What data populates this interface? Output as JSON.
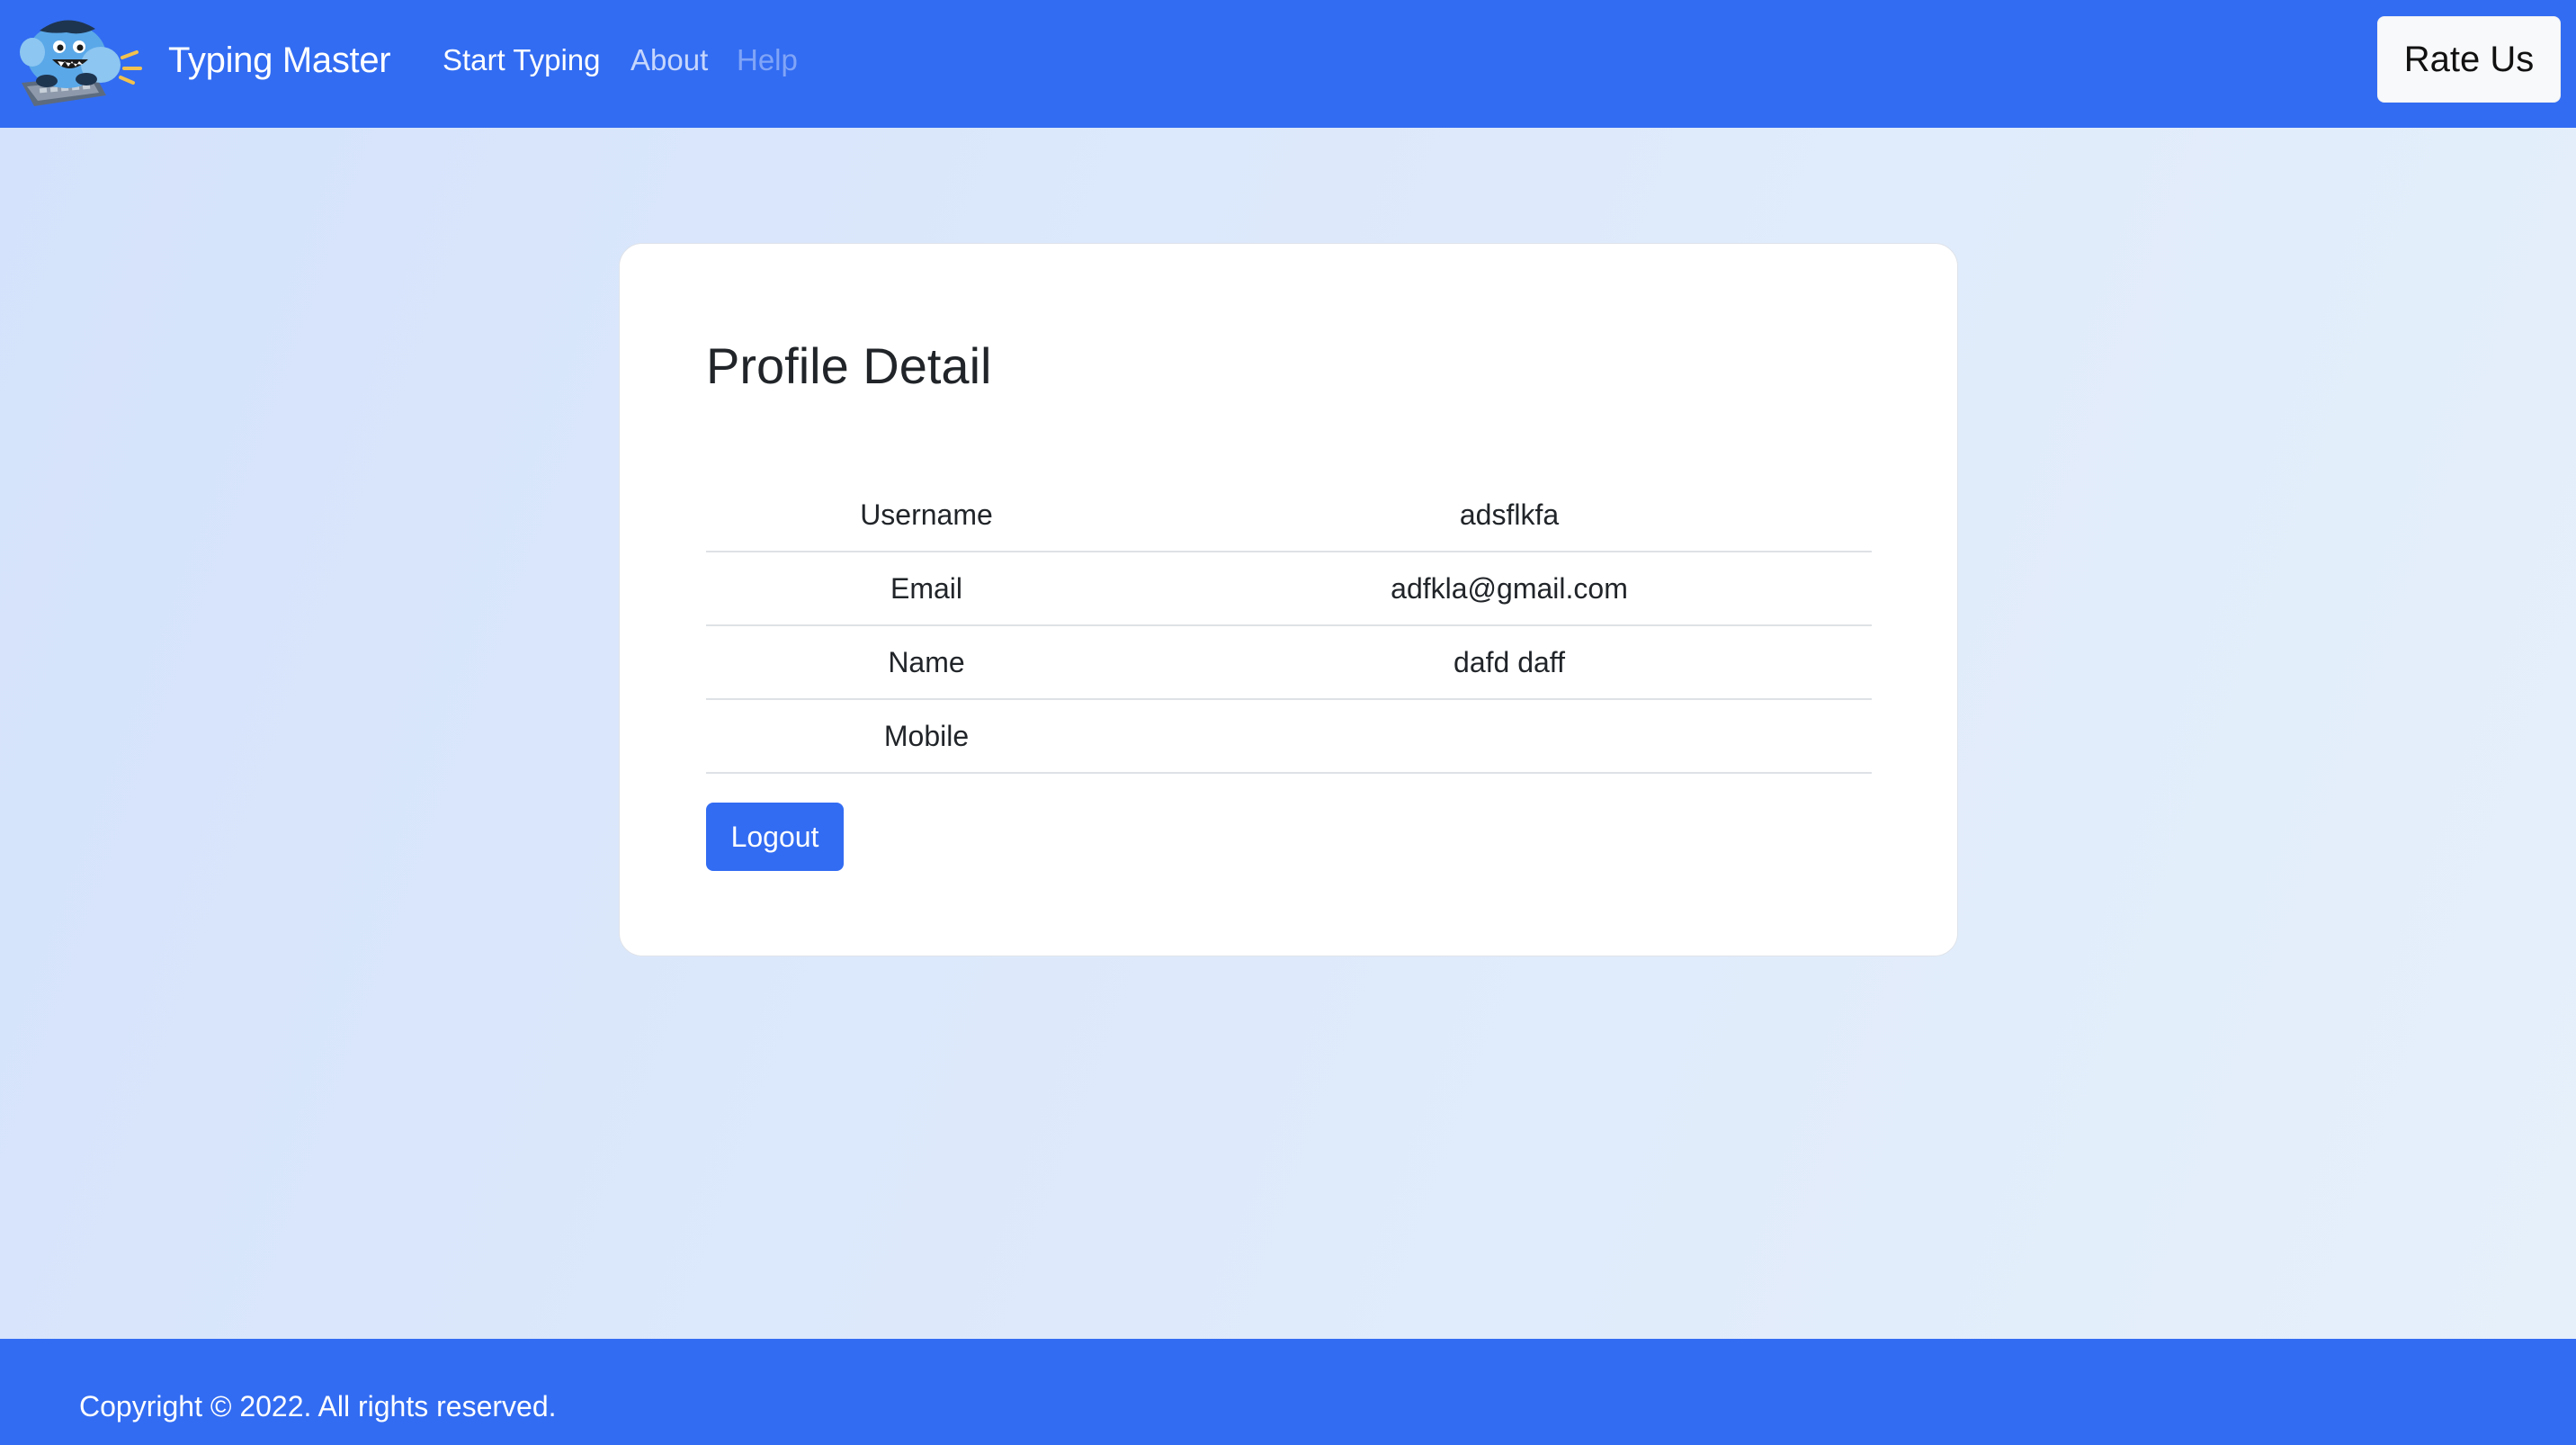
{
  "navbar": {
    "brand": "Typing Master",
    "links": [
      {
        "label": "Start Typing"
      },
      {
        "label": "About"
      },
      {
        "label": "Help"
      }
    ],
    "rate_button": "Rate Us",
    "background": "#326cf2"
  },
  "profile": {
    "title": "Profile Detail",
    "rows": [
      {
        "label": "Username",
        "value": "adsflkfa"
      },
      {
        "label": "Email",
        "value": "adfkla@gmail.com"
      },
      {
        "label": "Name",
        "value": "dafd daff"
      },
      {
        "label": "Mobile",
        "value": ""
      }
    ],
    "logout_button": "Logout"
  },
  "footer": {
    "text": "Copyright © 2022. All rights reserved."
  },
  "icons": {
    "logo": "typing-monster-logo-icon"
  }
}
